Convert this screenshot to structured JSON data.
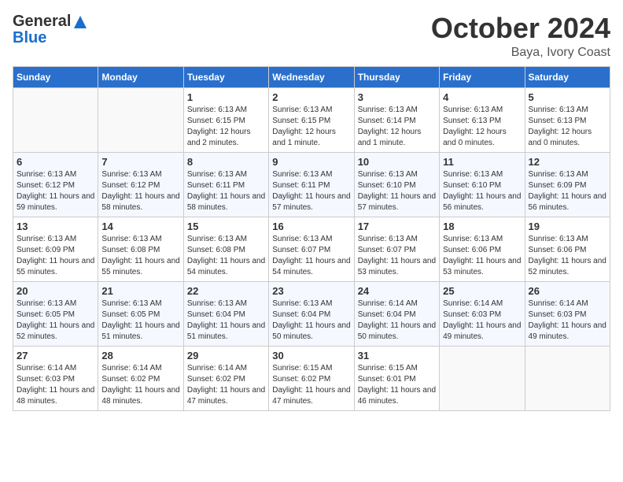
{
  "header": {
    "logo_general": "General",
    "logo_blue": "Blue",
    "month": "October 2024",
    "location": "Baya, Ivory Coast"
  },
  "weekdays": [
    "Sunday",
    "Monday",
    "Tuesday",
    "Wednesday",
    "Thursday",
    "Friday",
    "Saturday"
  ],
  "weeks": [
    [
      {
        "day": "",
        "sunrise": "",
        "sunset": "",
        "daylight": ""
      },
      {
        "day": "",
        "sunrise": "",
        "sunset": "",
        "daylight": ""
      },
      {
        "day": "1",
        "sunrise": "Sunrise: 6:13 AM",
        "sunset": "Sunset: 6:15 PM",
        "daylight": "Daylight: 12 hours and 2 minutes."
      },
      {
        "day": "2",
        "sunrise": "Sunrise: 6:13 AM",
        "sunset": "Sunset: 6:15 PM",
        "daylight": "Daylight: 12 hours and 1 minute."
      },
      {
        "day": "3",
        "sunrise": "Sunrise: 6:13 AM",
        "sunset": "Sunset: 6:14 PM",
        "daylight": "Daylight: 12 hours and 1 minute."
      },
      {
        "day": "4",
        "sunrise": "Sunrise: 6:13 AM",
        "sunset": "Sunset: 6:13 PM",
        "daylight": "Daylight: 12 hours and 0 minutes."
      },
      {
        "day": "5",
        "sunrise": "Sunrise: 6:13 AM",
        "sunset": "Sunset: 6:13 PM",
        "daylight": "Daylight: 12 hours and 0 minutes."
      }
    ],
    [
      {
        "day": "6",
        "sunrise": "Sunrise: 6:13 AM",
        "sunset": "Sunset: 6:12 PM",
        "daylight": "Daylight: 11 hours and 59 minutes."
      },
      {
        "day": "7",
        "sunrise": "Sunrise: 6:13 AM",
        "sunset": "Sunset: 6:12 PM",
        "daylight": "Daylight: 11 hours and 58 minutes."
      },
      {
        "day": "8",
        "sunrise": "Sunrise: 6:13 AM",
        "sunset": "Sunset: 6:11 PM",
        "daylight": "Daylight: 11 hours and 58 minutes."
      },
      {
        "day": "9",
        "sunrise": "Sunrise: 6:13 AM",
        "sunset": "Sunset: 6:11 PM",
        "daylight": "Daylight: 11 hours and 57 minutes."
      },
      {
        "day": "10",
        "sunrise": "Sunrise: 6:13 AM",
        "sunset": "Sunset: 6:10 PM",
        "daylight": "Daylight: 11 hours and 57 minutes."
      },
      {
        "day": "11",
        "sunrise": "Sunrise: 6:13 AM",
        "sunset": "Sunset: 6:10 PM",
        "daylight": "Daylight: 11 hours and 56 minutes."
      },
      {
        "day": "12",
        "sunrise": "Sunrise: 6:13 AM",
        "sunset": "Sunset: 6:09 PM",
        "daylight": "Daylight: 11 hours and 56 minutes."
      }
    ],
    [
      {
        "day": "13",
        "sunrise": "Sunrise: 6:13 AM",
        "sunset": "Sunset: 6:09 PM",
        "daylight": "Daylight: 11 hours and 55 minutes."
      },
      {
        "day": "14",
        "sunrise": "Sunrise: 6:13 AM",
        "sunset": "Sunset: 6:08 PM",
        "daylight": "Daylight: 11 hours and 55 minutes."
      },
      {
        "day": "15",
        "sunrise": "Sunrise: 6:13 AM",
        "sunset": "Sunset: 6:08 PM",
        "daylight": "Daylight: 11 hours and 54 minutes."
      },
      {
        "day": "16",
        "sunrise": "Sunrise: 6:13 AM",
        "sunset": "Sunset: 6:07 PM",
        "daylight": "Daylight: 11 hours and 54 minutes."
      },
      {
        "day": "17",
        "sunrise": "Sunrise: 6:13 AM",
        "sunset": "Sunset: 6:07 PM",
        "daylight": "Daylight: 11 hours and 53 minutes."
      },
      {
        "day": "18",
        "sunrise": "Sunrise: 6:13 AM",
        "sunset": "Sunset: 6:06 PM",
        "daylight": "Daylight: 11 hours and 53 minutes."
      },
      {
        "day": "19",
        "sunrise": "Sunrise: 6:13 AM",
        "sunset": "Sunset: 6:06 PM",
        "daylight": "Daylight: 11 hours and 52 minutes."
      }
    ],
    [
      {
        "day": "20",
        "sunrise": "Sunrise: 6:13 AM",
        "sunset": "Sunset: 6:05 PM",
        "daylight": "Daylight: 11 hours and 52 minutes."
      },
      {
        "day": "21",
        "sunrise": "Sunrise: 6:13 AM",
        "sunset": "Sunset: 6:05 PM",
        "daylight": "Daylight: 11 hours and 51 minutes."
      },
      {
        "day": "22",
        "sunrise": "Sunrise: 6:13 AM",
        "sunset": "Sunset: 6:04 PM",
        "daylight": "Daylight: 11 hours and 51 minutes."
      },
      {
        "day": "23",
        "sunrise": "Sunrise: 6:13 AM",
        "sunset": "Sunset: 6:04 PM",
        "daylight": "Daylight: 11 hours and 50 minutes."
      },
      {
        "day": "24",
        "sunrise": "Sunrise: 6:14 AM",
        "sunset": "Sunset: 6:04 PM",
        "daylight": "Daylight: 11 hours and 50 minutes."
      },
      {
        "day": "25",
        "sunrise": "Sunrise: 6:14 AM",
        "sunset": "Sunset: 6:03 PM",
        "daylight": "Daylight: 11 hours and 49 minutes."
      },
      {
        "day": "26",
        "sunrise": "Sunrise: 6:14 AM",
        "sunset": "Sunset: 6:03 PM",
        "daylight": "Daylight: 11 hours and 49 minutes."
      }
    ],
    [
      {
        "day": "27",
        "sunrise": "Sunrise: 6:14 AM",
        "sunset": "Sunset: 6:03 PM",
        "daylight": "Daylight: 11 hours and 48 minutes."
      },
      {
        "day": "28",
        "sunrise": "Sunrise: 6:14 AM",
        "sunset": "Sunset: 6:02 PM",
        "daylight": "Daylight: 11 hours and 48 minutes."
      },
      {
        "day": "29",
        "sunrise": "Sunrise: 6:14 AM",
        "sunset": "Sunset: 6:02 PM",
        "daylight": "Daylight: 11 hours and 47 minutes."
      },
      {
        "day": "30",
        "sunrise": "Sunrise: 6:15 AM",
        "sunset": "Sunset: 6:02 PM",
        "daylight": "Daylight: 11 hours and 47 minutes."
      },
      {
        "day": "31",
        "sunrise": "Sunrise: 6:15 AM",
        "sunset": "Sunset: 6:01 PM",
        "daylight": "Daylight: 11 hours and 46 minutes."
      },
      {
        "day": "",
        "sunrise": "",
        "sunset": "",
        "daylight": ""
      },
      {
        "day": "",
        "sunrise": "",
        "sunset": "",
        "daylight": ""
      }
    ]
  ]
}
